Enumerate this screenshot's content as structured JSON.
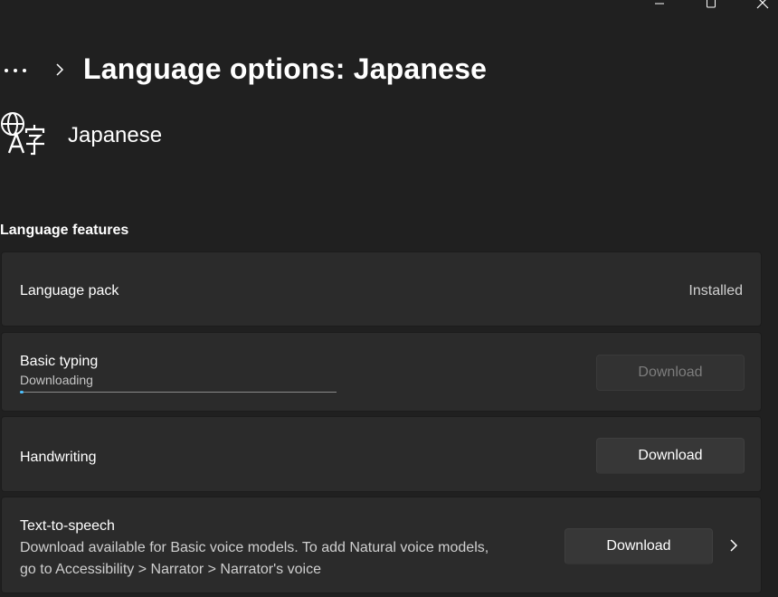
{
  "window": {
    "minimize_label": "Minimize",
    "maximize_label": "Maximize",
    "close_label": "Close"
  },
  "header": {
    "title": "Language options: Japanese"
  },
  "language": {
    "name": "Japanese",
    "icon": "language-icon"
  },
  "section": {
    "title": "Language features"
  },
  "features": {
    "language_pack": {
      "label": "Language pack",
      "status": "Installed"
    },
    "basic_typing": {
      "label": "Basic typing",
      "status": "Downloading",
      "progress": 0.01,
      "button_label": "Download",
      "button_enabled": false
    },
    "handwriting": {
      "label": "Handwriting",
      "button_label": "Download"
    },
    "tts": {
      "label": "Text-to-speech",
      "description_line1": "Download available for Basic voice models. To add Natural voice models,",
      "description_line2": "go to Accessibility > Narrator > Narrator's voice",
      "button_label": "Download"
    }
  },
  "colors": {
    "background": "#202020",
    "card": "#2b2b2b",
    "accent": "#4cc2ff",
    "text": "#ffffff",
    "secondary_text": "#c5c5c5",
    "disabled_text": "#7d7d7d"
  }
}
